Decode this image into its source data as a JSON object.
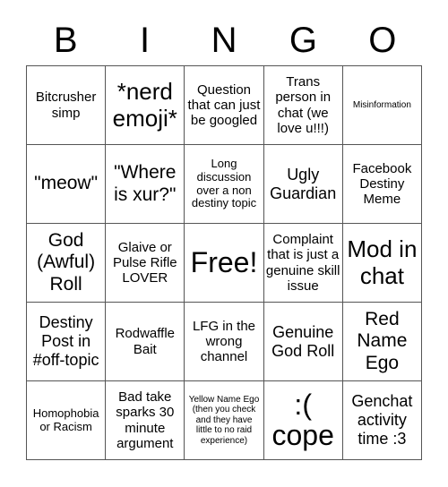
{
  "header": {
    "letters": [
      "B",
      "I",
      "N",
      "G",
      "O"
    ]
  },
  "cells": [
    {
      "text": "Bitcrusher simp"
    },
    {
      "text": "*nerd emoji*"
    },
    {
      "text": "Question that can just be googled"
    },
    {
      "text": "Trans person in chat (we love u!!!)"
    },
    {
      "text": "Misinformation"
    },
    {
      "text": "\"meow\""
    },
    {
      "text": "\"Where is xur?\""
    },
    {
      "text": "Long discussion over a non destiny topic"
    },
    {
      "text": "Ugly Guardian"
    },
    {
      "text": "Facebook Destiny Meme"
    },
    {
      "text": "God (Awful) Roll"
    },
    {
      "text": "Glaive or Pulse Rifle LOVER"
    },
    {
      "text": "Free!"
    },
    {
      "text": "Complaint that is just a genuine skill issue"
    },
    {
      "text": "Mod in chat"
    },
    {
      "text": "Destiny Post in #off-topic"
    },
    {
      "text": "Rodwaffle Bait"
    },
    {
      "text": "LFG in the wrong channel"
    },
    {
      "text": "Genuine God Roll"
    },
    {
      "text": "Red Name Ego"
    },
    {
      "text": "Homophobia or Racism"
    },
    {
      "text": "Bad take sparks 30 minute argument"
    },
    {
      "text": "Yellow Name Ego (then you check and they have little to no raid experience)"
    },
    {
      "text": ":( cope"
    },
    {
      "text": "Genchat activity time :3"
    }
  ]
}
